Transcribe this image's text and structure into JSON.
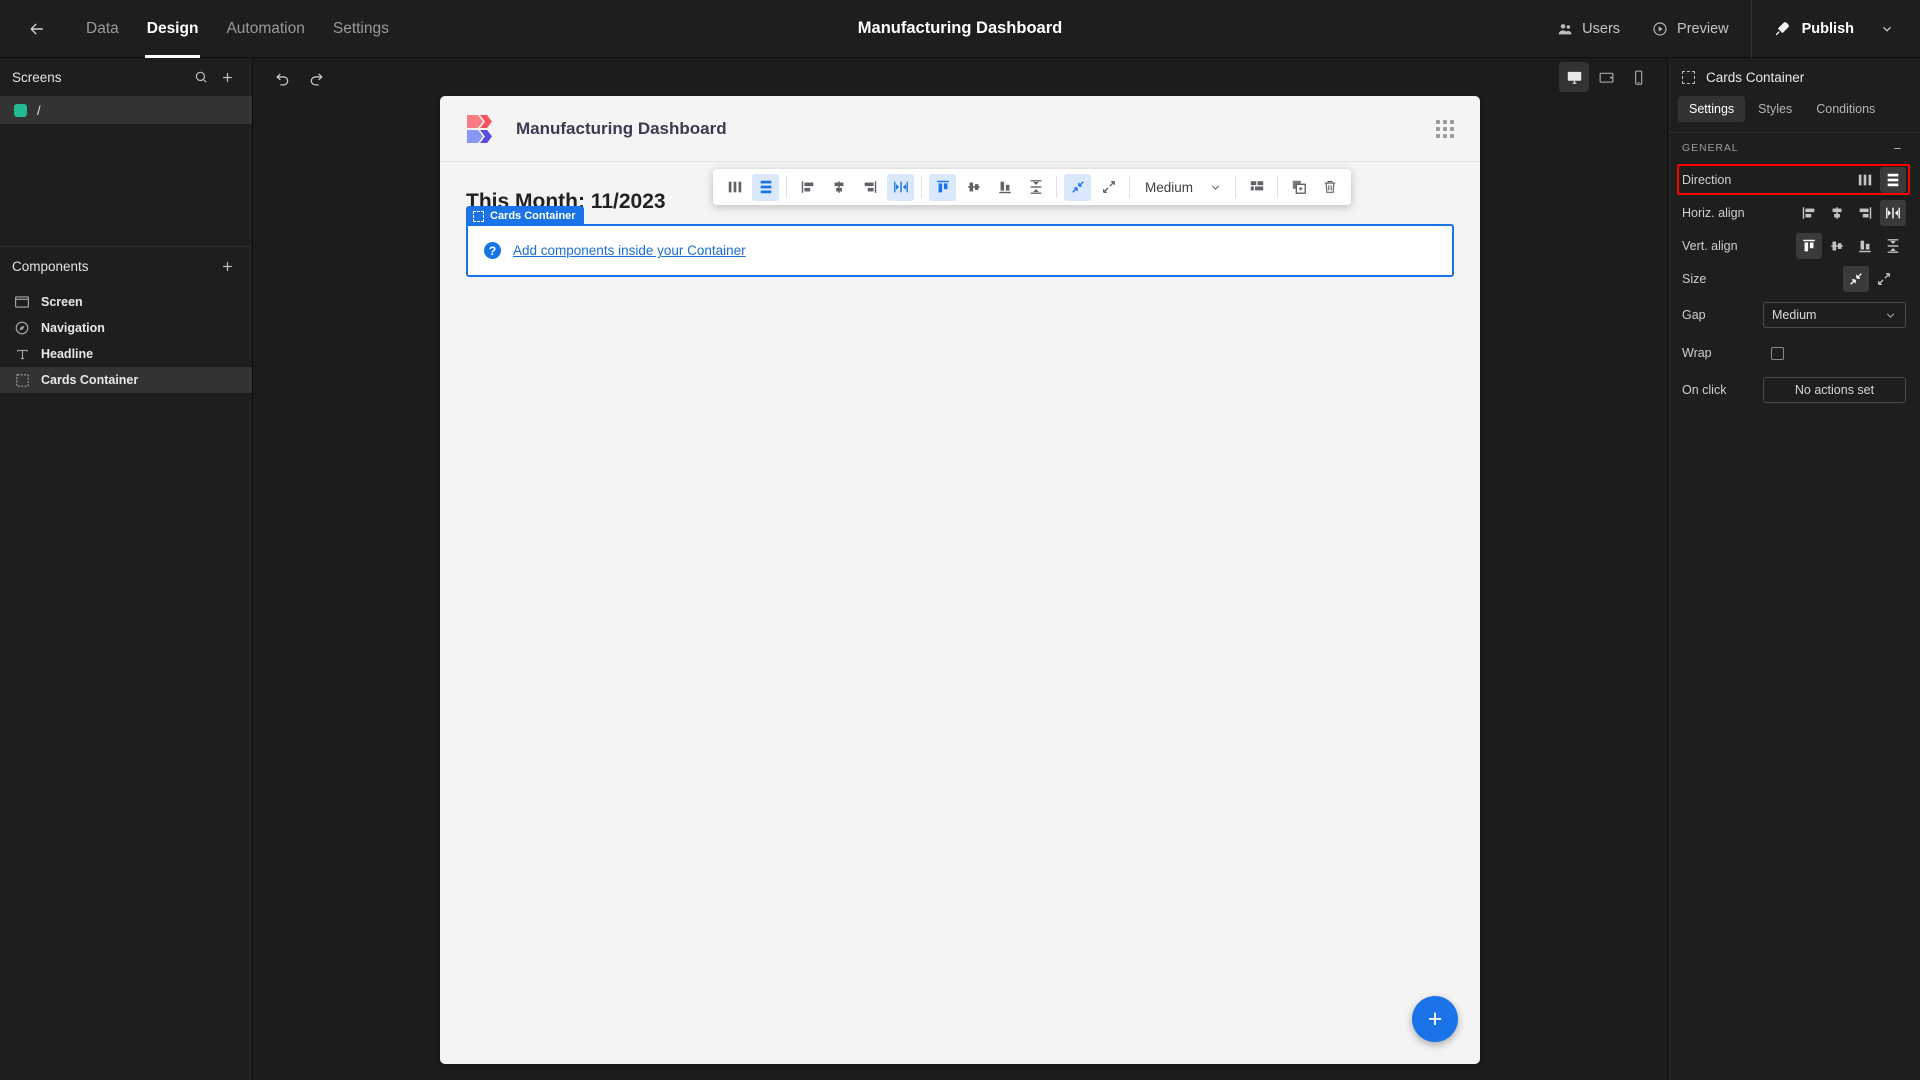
{
  "topbar": {
    "back_icon": "arrow-left-icon",
    "tabs": [
      {
        "label": "Data",
        "active": false
      },
      {
        "label": "Design",
        "active": true
      },
      {
        "label": "Automation",
        "active": false
      },
      {
        "label": "Settings",
        "active": false
      }
    ],
    "title": "Manufacturing Dashboard",
    "users_label": "Users",
    "preview_label": "Preview",
    "publish_label": "Publish"
  },
  "sidebar": {
    "screens": {
      "title": "Screens",
      "search_icon": "search-icon",
      "add_icon": "plus-icon",
      "items": [
        {
          "label": "/",
          "color": "#21ba91",
          "selected": true
        }
      ]
    },
    "components": {
      "title": "Components",
      "add_icon": "plus-icon",
      "items": [
        {
          "label": "Screen",
          "icon": "screen-icon",
          "selected": false
        },
        {
          "label": "Navigation",
          "icon": "navigation-icon",
          "selected": false
        },
        {
          "label": "Headline",
          "icon": "text-icon",
          "selected": false
        },
        {
          "label": "Cards Container",
          "icon": "container-icon",
          "selected": true
        }
      ]
    }
  },
  "canvas_bar": {
    "undo_icon": "undo-icon",
    "redo_icon": "redo-icon",
    "devices": [
      {
        "name": "desktop",
        "active": true
      },
      {
        "name": "tablet",
        "active": false
      },
      {
        "name": "mobile",
        "active": false
      }
    ]
  },
  "canvas": {
    "app_name": "Manufacturing Dashboard",
    "grip_icon": "grip-dots-icon",
    "headline": "This Month: 11/2023",
    "container_tag": "Cards Container",
    "hint_text": "Add components inside your Container",
    "fab_label": "+"
  },
  "floating_toolbar": {
    "direction": [
      {
        "name": "direction-column",
        "active": false
      },
      {
        "name": "direction-row",
        "active": true
      }
    ],
    "horiz_align": [
      {
        "name": "align-left",
        "active": false
      },
      {
        "name": "align-center",
        "active": false
      },
      {
        "name": "align-right",
        "active": false
      },
      {
        "name": "align-space-between",
        "active": true
      }
    ],
    "vert_align": [
      {
        "name": "align-top",
        "active": true
      },
      {
        "name": "align-middle",
        "active": false
      },
      {
        "name": "align-bottom",
        "active": false
      },
      {
        "name": "align-stretch",
        "active": false
      }
    ],
    "size": [
      {
        "name": "size-shrink",
        "active": true
      },
      {
        "name": "size-grow",
        "active": false
      }
    ],
    "gap_value": "Medium",
    "layout_icon": "layout-grid-icon",
    "duplicate_icon": "duplicate-icon",
    "delete_icon": "trash-icon"
  },
  "right_panel": {
    "title": "Cards Container",
    "title_icon": "container-icon",
    "tabs": [
      {
        "label": "Settings",
        "active": true
      },
      {
        "label": "Styles",
        "active": false
      },
      {
        "label": "Conditions",
        "active": false
      }
    ],
    "section": {
      "title": "GENERAL",
      "collapse_icon": "minus-icon"
    },
    "rows": {
      "direction": {
        "label": "Direction",
        "highlighted": true,
        "options": [
          {
            "name": "direction-column",
            "active": false
          },
          {
            "name": "direction-row",
            "active": true
          }
        ]
      },
      "horiz_align": {
        "label": "Horiz. align",
        "options": [
          {
            "name": "align-left",
            "active": false
          },
          {
            "name": "align-center",
            "active": false
          },
          {
            "name": "align-right",
            "active": false
          },
          {
            "name": "align-space-between",
            "active": true
          }
        ]
      },
      "vert_align": {
        "label": "Vert. align",
        "options": [
          {
            "name": "align-top",
            "active": true
          },
          {
            "name": "align-middle",
            "active": false
          },
          {
            "name": "align-bottom",
            "active": false
          },
          {
            "name": "align-stretch",
            "active": false
          }
        ]
      },
      "size": {
        "label": "Size",
        "options": [
          {
            "name": "size-shrink",
            "active": true
          },
          {
            "name": "size-grow",
            "active": false
          }
        ]
      },
      "gap": {
        "label": "Gap",
        "value": "Medium"
      },
      "wrap": {
        "label": "Wrap",
        "checked": false
      },
      "on_click": {
        "label": "On click",
        "value": "No actions set"
      }
    }
  },
  "colors": {
    "accent_blue": "#1a73e8",
    "highlight_red": "#ff0000",
    "screen_green": "#21ba91",
    "dark_bg": "#1e1e1e",
    "canvas_bg": "#f4f4f4"
  }
}
